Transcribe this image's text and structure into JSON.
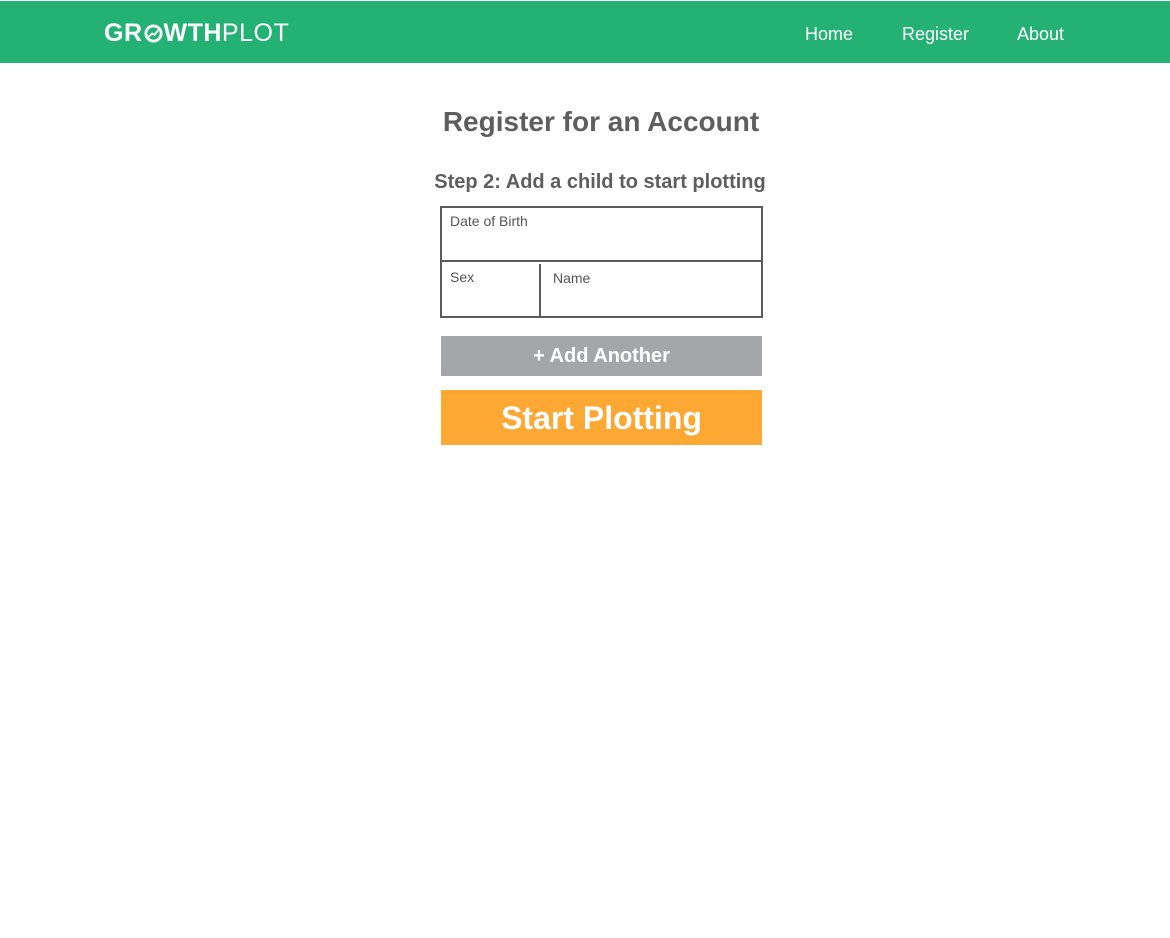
{
  "header": {
    "logo": {
      "part_bold_1": "GR",
      "part_bold_2": "WTH",
      "part_light": "PLOT",
      "o_icon": "trend-circle-icon"
    },
    "nav": [
      {
        "label": "Home"
      },
      {
        "label": "Register"
      },
      {
        "label": "About"
      }
    ]
  },
  "main": {
    "title": "Register for an Account",
    "step_title": "Step 2: Add a child to start plotting",
    "form": {
      "dob_label": "Date of Birth",
      "dob_value": "",
      "sex_label": "Sex",
      "sex_value": "",
      "name_label": "Name",
      "name_value": ""
    },
    "add_another_label": "+ Add Another",
    "start_label": "Start Plotting"
  },
  "colors": {
    "brand_green": "#23b274",
    "text_gray": "#5e5e5e",
    "add_button_gray": "#a5a6aa",
    "start_button_orange": "#fea834"
  }
}
